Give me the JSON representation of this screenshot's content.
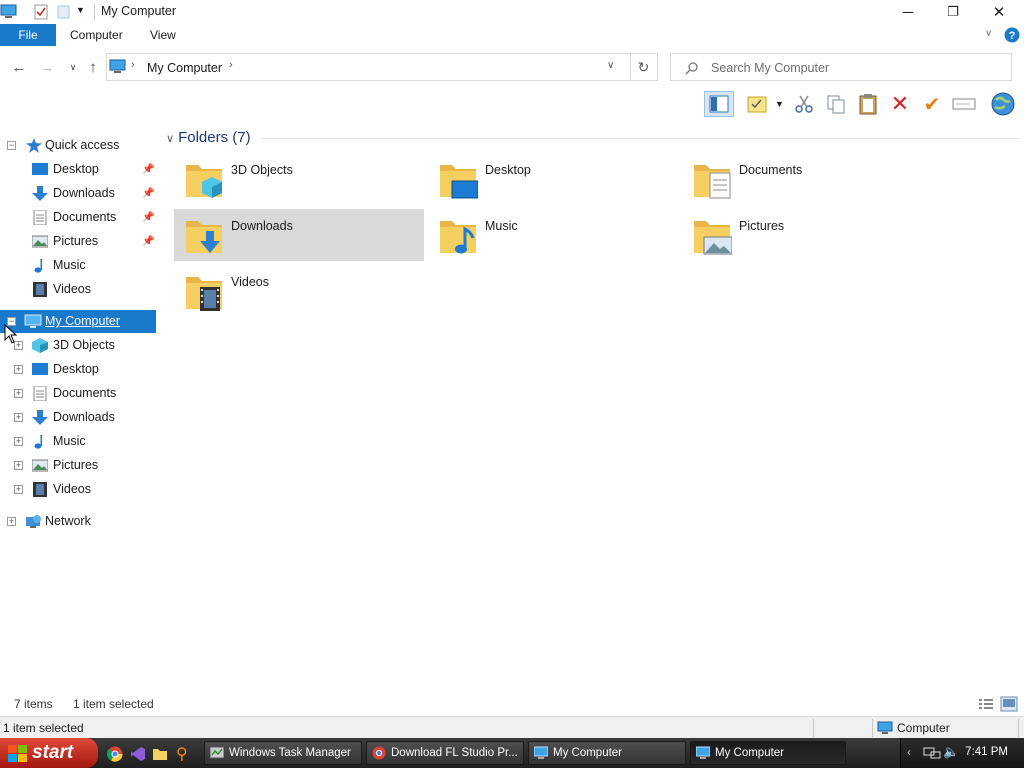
{
  "window": {
    "title": "My Computer",
    "minimize": "─",
    "restore": "❐",
    "close": "✕"
  },
  "ribbon": {
    "tabs": [
      "File",
      "Computer",
      "View"
    ]
  },
  "address": {
    "path": "My Computer",
    "search_placeholder": "Search My Computer"
  },
  "nav": {
    "quick_access": "Quick access",
    "quick_items": [
      {
        "label": "Desktop",
        "pinned": true
      },
      {
        "label": "Downloads",
        "pinned": true
      },
      {
        "label": "Documents",
        "pinned": true
      },
      {
        "label": "Pictures",
        "pinned": true
      },
      {
        "label": "Music",
        "pinned": false
      },
      {
        "label": "Videos",
        "pinned": false
      }
    ],
    "computer": "My Computer",
    "computer_items": [
      "3D Objects",
      "Desktop",
      "Documents",
      "Downloads",
      "Music",
      "Pictures",
      "Videos"
    ],
    "network": "Network"
  },
  "content": {
    "group_header": "Folders (7)",
    "folders": [
      "3D Objects",
      "Desktop",
      "Documents",
      "Downloads",
      "Music",
      "Pictures",
      "Videos"
    ],
    "selected": "Downloads"
  },
  "status": {
    "count": "7 items",
    "selection": "1 item selected",
    "bottom_left": "1 item selected",
    "bottom_right": "Computer"
  },
  "taskbar": {
    "start": "start",
    "tasks": [
      {
        "label": "Windows Task Manager",
        "active": false
      },
      {
        "label": "Download FL Studio Pr...",
        "active": false
      },
      {
        "label": "My Computer",
        "active": false
      },
      {
        "label": "My Computer",
        "active": true
      }
    ],
    "clock": "7:41 PM"
  },
  "colors": {
    "accent": "#1979ca",
    "folder": "#f3c94e",
    "selection": "#d9d9d9"
  }
}
